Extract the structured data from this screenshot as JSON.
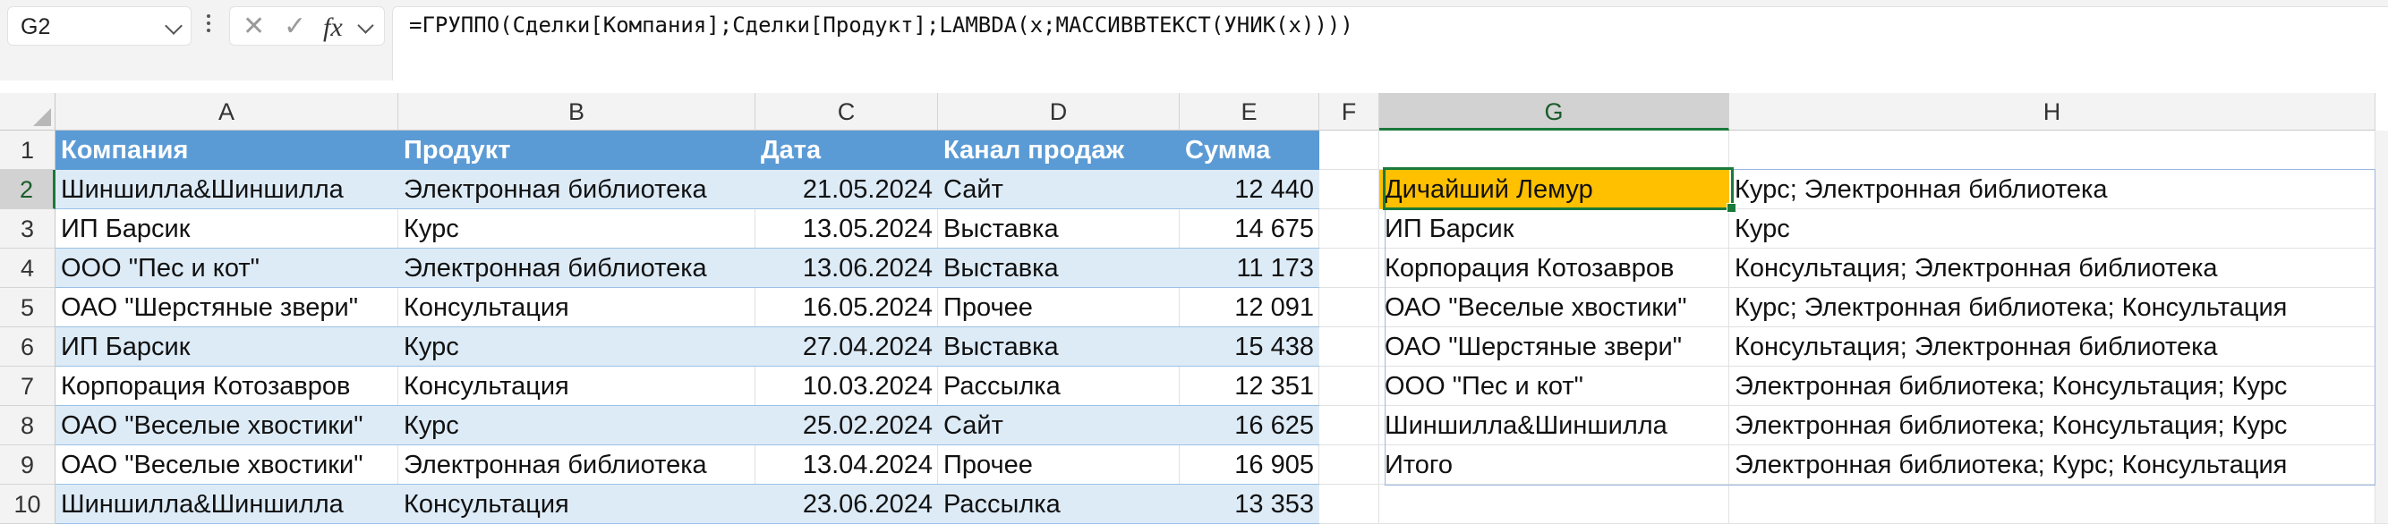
{
  "name_box": {
    "value": "G2"
  },
  "formula_bar": {
    "formula": "=ГРУППО(Сделки[Компания];Сделки[Продукт];LAMBDA(x;МАССИВВТЕКСТ(УНИК(x))))",
    "cancel_icon": "close-icon",
    "enter_icon": "checkmark-icon",
    "fx_label": "fx"
  },
  "columns": [
    "A",
    "B",
    "C",
    "D",
    "E",
    "F",
    "G",
    "H"
  ],
  "selected_column": "G",
  "rows": [
    "1",
    "2",
    "3",
    "4",
    "5",
    "6",
    "7",
    "8",
    "9",
    "10"
  ],
  "selected_row": "2",
  "table": {
    "headers": [
      "Компания",
      "Продукт",
      "Дата",
      "Канал продаж",
      "Сумма"
    ],
    "rows": [
      [
        "Шиншилла&Шиншилла",
        "Электронная библиотека",
        "21.05.2024",
        "Сайт",
        "12 440"
      ],
      [
        "ИП Барсик",
        "Курс",
        "13.05.2024",
        "Выставка",
        "14 675"
      ],
      [
        "ООО \"Пес и кот\"",
        "Электронная библиотека",
        "13.06.2024",
        "Выставка",
        "11 173"
      ],
      [
        "ОАО \"Шерстяные звери\"",
        "Консультация",
        "16.05.2024",
        "Прочее",
        "12 091"
      ],
      [
        "ИП Барсик",
        "Курс",
        "27.04.2024",
        "Выставка",
        "15 438"
      ],
      [
        "Корпорация Котозавров",
        "Консультация",
        "10.03.2024",
        "Рассылка",
        "12 351"
      ],
      [
        "ОАО \"Веселые хвостики\"",
        "Курс",
        "25.02.2024",
        "Сайт",
        "16 625"
      ],
      [
        "ОАО \"Веселые хвостики\"",
        "Электронная библиотека",
        "13.04.2024",
        "Прочее",
        "16 905"
      ],
      [
        "Шиншилла&Шиншилла",
        "Консультация",
        "23.06.2024",
        "Рассылка",
        "13 353"
      ]
    ]
  },
  "result": {
    "rows": [
      [
        "Дичайший Лемур",
        "Курс; Электронная библиотека"
      ],
      [
        "ИП Барсик",
        "Курс"
      ],
      [
        "Корпорация Котозавров",
        "Консультация; Электронная библиотека"
      ],
      [
        "ОАО \"Веселые хвостики\"",
        "Курс; Электронная библиотека; Консультация"
      ],
      [
        "ОАО \"Шерстяные звери\"",
        "Консультация; Электронная библиотека"
      ],
      [
        "ООО \"Пес и кот\"",
        "Электронная библиотека; Консультация; Курс"
      ],
      [
        "Шиншилла&Шиншилла",
        "Электронная библиотека; Консультация; Курс"
      ],
      [
        "Итого",
        "Электронная библиотека; Курс; Консультация"
      ]
    ],
    "highlight_color": "#ffc000"
  },
  "colors": {
    "table_header": "#5b9bd5",
    "table_band": "#ddebf7",
    "selection": "#1a7a3a"
  }
}
